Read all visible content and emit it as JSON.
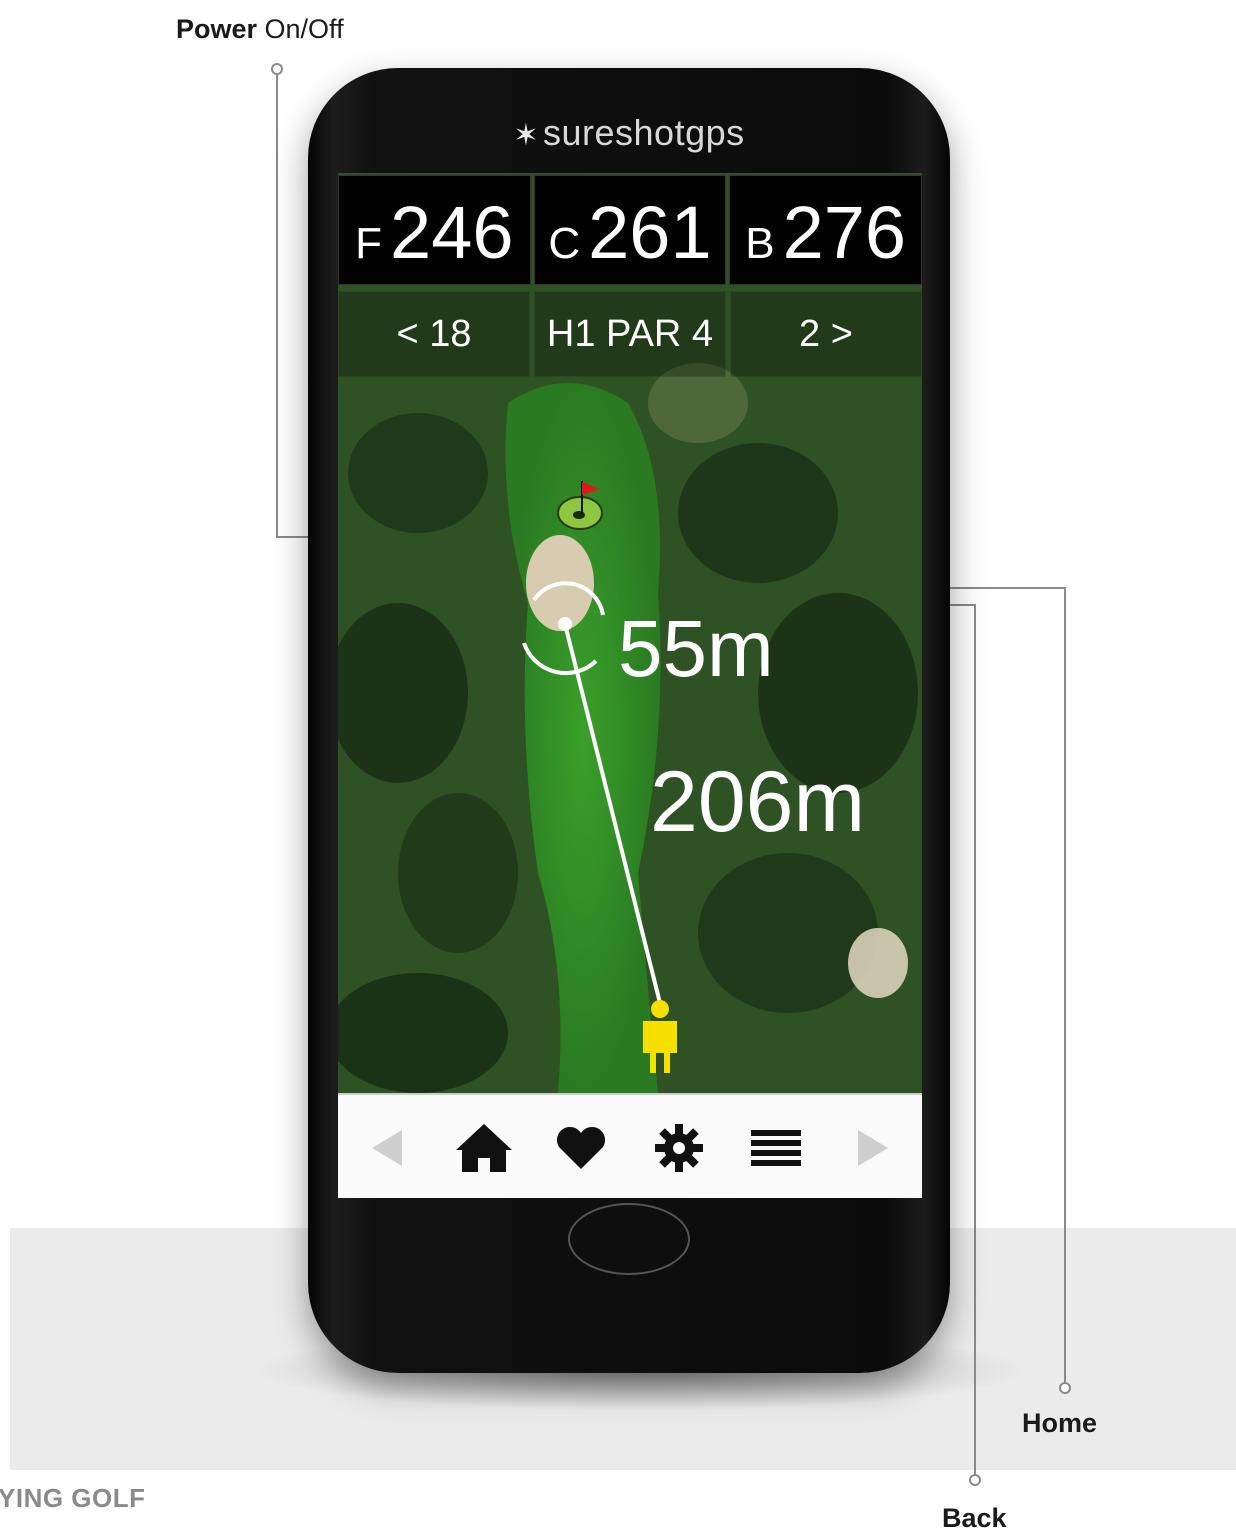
{
  "callouts": {
    "power_bold": "Power",
    "power_rest": " On/Off",
    "home": "Home",
    "back": "Back"
  },
  "footer": {
    "text": "YING GOLF"
  },
  "device": {
    "brand": "sureshotgps",
    "distances": [
      {
        "label": "F",
        "value": "246"
      },
      {
        "label": "C",
        "value": "261"
      },
      {
        "label": "B",
        "value": "276"
      }
    ],
    "hole_nav": {
      "prev": "< 18",
      "current": "H1 PAR 4",
      "next": "2 >"
    },
    "map": {
      "distance_to_green": "55m",
      "distance_to_target": "206m"
    },
    "toolbar": {
      "items": [
        "left-arrow-icon",
        "home-icon",
        "heart-icon",
        "gear-icon",
        "menu-icon",
        "right-arrow-icon"
      ]
    }
  },
  "colors": {
    "player": "#f5e000",
    "flag": "#e01818",
    "green": "#8dc63f"
  }
}
